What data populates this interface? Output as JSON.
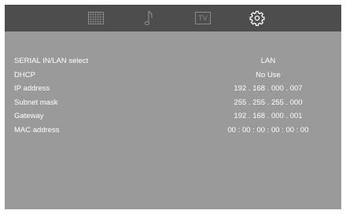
{
  "menu": {
    "tabs": [
      {
        "icon": "picture-grid-icon"
      },
      {
        "icon": "music-note-icon"
      },
      {
        "icon": "tv-icon",
        "label": "TV"
      },
      {
        "icon": "gear-icon",
        "active": true
      }
    ]
  },
  "network_settings": {
    "rows": [
      {
        "label": "SERIAL IN/LAN select",
        "value": "LAN"
      },
      {
        "label": "DHCP",
        "value": "No Use"
      },
      {
        "label": "IP address",
        "value": "192 . 168 . 000 . 007"
      },
      {
        "label": "Subnet mask",
        "value": "255 . 255 . 255 . 000"
      },
      {
        "label": "Gateway",
        "value": "192 . 168 . 000 . 001"
      },
      {
        "label": "MAC address",
        "value": "00 : 00 : 00 : 00 : 00 : 00"
      }
    ]
  },
  "colors": {
    "background": "#9a9a9a",
    "menu_bar": "#4d4d4d",
    "inactive_icon": "#8a8a8a",
    "active_icon": "#ffffff",
    "text": "#ffffff"
  }
}
